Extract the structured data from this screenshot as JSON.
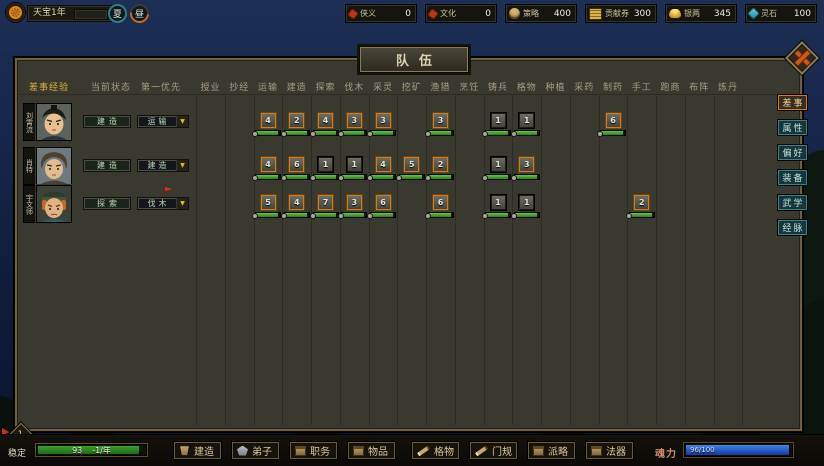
{
  "top_bar": {
    "date": "天宝1年",
    "season_badge": "夏",
    "daytime_badge": "昼",
    "resources": [
      {
        "icon": "chivalry-icon",
        "label": "侠义",
        "value": "0"
      },
      {
        "icon": "culture-icon",
        "label": "文化",
        "value": "0"
      },
      {
        "icon": "strategy-icon",
        "label": "策略",
        "value": "400"
      },
      {
        "icon": "voucher-icon",
        "label": "贡献券",
        "value": "300"
      },
      {
        "icon": "silver-icon",
        "label": "银两",
        "value": "345"
      },
      {
        "icon": "spirit-stone-icon",
        "label": "灵石",
        "value": "100"
      }
    ]
  },
  "panel": {
    "title": "队伍",
    "side_tabs": [
      {
        "label": "差事",
        "active": true
      },
      {
        "label": "属性",
        "active": false
      },
      {
        "label": "偏好",
        "active": false
      },
      {
        "label": "装备",
        "active": false
      },
      {
        "label": "武学",
        "active": false
      },
      {
        "label": "经脉",
        "active": false
      }
    ],
    "fixed_headers": [
      "差事经验",
      "当前状态",
      "第一优先"
    ],
    "skill_headers": [
      "授业",
      "抄经",
      "运输",
      "建造",
      "探索",
      "伐木",
      "采灵",
      "挖矿",
      "渔猎",
      "烹饪",
      "铸兵",
      "格物",
      "种植",
      "采药",
      "制药",
      "手工",
      "跑商",
      "布阵",
      "炼丹"
    ],
    "rows": [
      {
        "name": "刘霄流",
        "status": "建造",
        "priority": "运输",
        "alert": false,
        "skills": [
          {
            "col": 2,
            "value": "4",
            "highlight": true
          },
          {
            "col": 3,
            "value": "2",
            "highlight": true
          },
          {
            "col": 4,
            "value": "4",
            "highlight": true
          },
          {
            "col": 5,
            "value": "3",
            "highlight": true
          },
          {
            "col": 6,
            "value": "3",
            "highlight": true
          },
          {
            "col": 8,
            "value": "3",
            "highlight": true
          },
          {
            "col": 10,
            "value": "1",
            "highlight": false
          },
          {
            "col": 11,
            "value": "1",
            "highlight": false
          },
          {
            "col": 14,
            "value": "6",
            "highlight": true
          }
        ]
      },
      {
        "name": "肖特",
        "status": "建造",
        "priority": "建造",
        "alert": false,
        "skills": [
          {
            "col": 2,
            "value": "4",
            "highlight": true
          },
          {
            "col": 3,
            "value": "6",
            "highlight": true
          },
          {
            "col": 4,
            "value": "1",
            "highlight": false
          },
          {
            "col": 5,
            "value": "1",
            "highlight": false
          },
          {
            "col": 6,
            "value": "4",
            "highlight": true
          },
          {
            "col": 7,
            "value": "5",
            "highlight": true
          },
          {
            "col": 8,
            "value": "2",
            "highlight": true
          },
          {
            "col": 10,
            "value": "1",
            "highlight": false
          },
          {
            "col": 11,
            "value": "3",
            "highlight": true
          }
        ]
      },
      {
        "name": "宇文师",
        "status": "探索",
        "priority": "伐木",
        "alert": true,
        "skills": [
          {
            "col": 2,
            "value": "5",
            "highlight": true
          },
          {
            "col": 3,
            "value": "4",
            "highlight": true
          },
          {
            "col": 4,
            "value": "7",
            "highlight": true
          },
          {
            "col": 5,
            "value": "3",
            "highlight": true
          },
          {
            "col": 6,
            "value": "6",
            "highlight": true
          },
          {
            "col": 8,
            "value": "6",
            "highlight": true
          },
          {
            "col": 10,
            "value": "1",
            "highlight": false
          },
          {
            "col": 11,
            "value": "1",
            "highlight": false
          },
          {
            "col": 15,
            "value": "2",
            "highlight": true
          }
        ]
      }
    ]
  },
  "bottom_bar": {
    "level_badge": "1",
    "stability_label": "稳定",
    "stability_value": "93",
    "stability_rate": "-1/年",
    "buttons": [
      {
        "icon": "build-icon",
        "label": "建造"
      },
      {
        "icon": "disciple-icon",
        "label": "弟子"
      },
      {
        "icon": "duty-icon",
        "label": "职务"
      },
      {
        "icon": "item-icon",
        "label": "物品"
      },
      {
        "icon": "gewu-icon",
        "label": "格物"
      },
      {
        "icon": "rules-icon",
        "label": "门规"
      },
      {
        "icon": "faction-icon",
        "label": "派略"
      },
      {
        "icon": "artifact-icon",
        "label": "法器"
      }
    ],
    "soul_label": "魂力",
    "soul_value": "96/100"
  },
  "colors": {
    "highlight_border": "#d07d1f",
    "progress_green": "#3f9e2a",
    "soul_blue": "#2e6fd8",
    "active_header": "#d9b33c"
  }
}
